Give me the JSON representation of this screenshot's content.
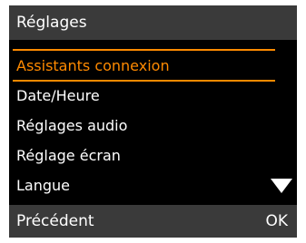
{
  "header": {
    "title": "Réglages"
  },
  "menu": {
    "items": [
      {
        "label": "Assistants connexion",
        "selected": true
      },
      {
        "label": "Date/Heure",
        "selected": false
      },
      {
        "label": "Réglages audio",
        "selected": false
      },
      {
        "label": "Réglage écran",
        "selected": false
      },
      {
        "label": "Langue",
        "selected": false
      }
    ],
    "scroll_indicator_icon": "triangle-down-icon"
  },
  "softkeys": {
    "left_label": "Précédent",
    "right_label": "OK"
  },
  "colors": {
    "background": "#000000",
    "bar": "#3a3a3a",
    "text": "#ffffff",
    "accent": "#ff8a00"
  }
}
